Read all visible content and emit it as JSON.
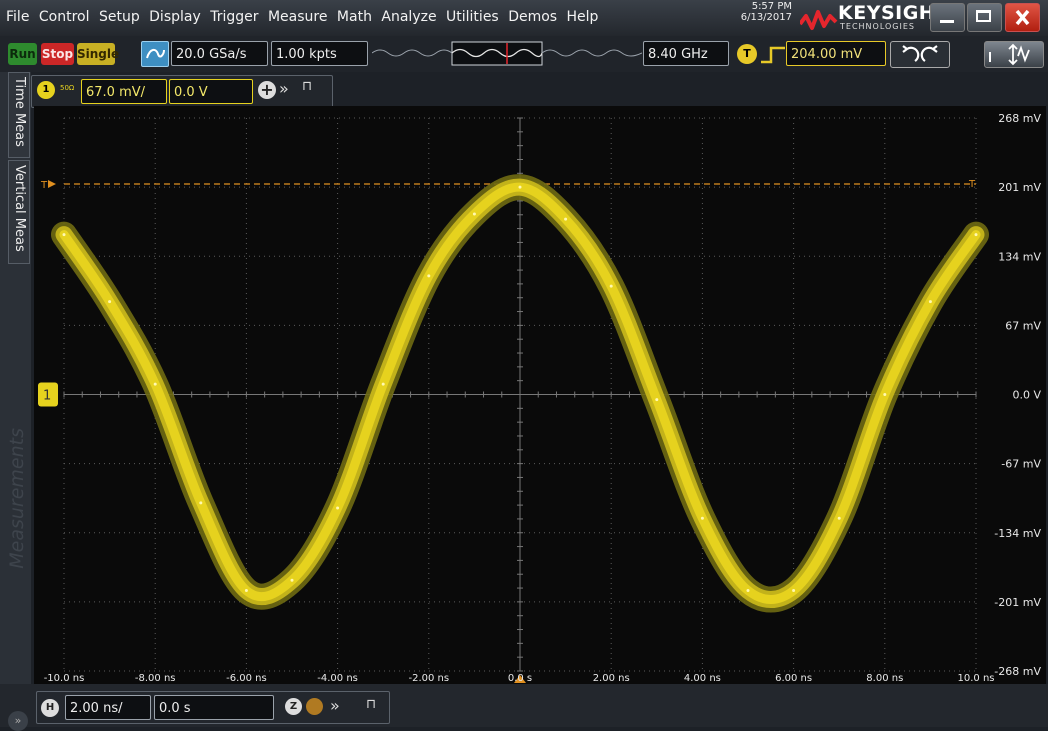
{
  "menu": [
    "File",
    "Control",
    "Setup",
    "Display",
    "Trigger",
    "Measure",
    "Math",
    "Analyze",
    "Utilities",
    "Demos",
    "Help"
  ],
  "clock": {
    "time": "5:57 PM",
    "date": "6/13/2017"
  },
  "brand": {
    "name": "KEYSIGHT",
    "sub": "TECHNOLOGIES"
  },
  "toolbar": {
    "run": "Run",
    "stop": "Stop",
    "single": "Single",
    "sample_rate": "20.0 GSa/s",
    "points": "1.00 kpts",
    "bandwidth": "8.40 GHz",
    "trigger_icon": "T",
    "trigger_level": "204.00 mV"
  },
  "sidebar": {
    "time_meas": "Time Meas",
    "vertical_meas": "Vertical Meas",
    "measurements": "Measurements"
  },
  "channel1": {
    "number": "1",
    "impedance": "50Ω",
    "scale": "67.0 mV/",
    "offset": "0.0 V"
  },
  "horizontal": {
    "icon": "H",
    "scale": "2.00 ns/",
    "position": "0.0 s",
    "zoom": "Z"
  },
  "icons": {
    "plus": "+",
    "more": "»",
    "pin": "⊓",
    "expand": "»",
    "trigger_marker": "T",
    "run_state": "acquisition-mode-icon"
  },
  "colors": {
    "channel1": "#e6d21e",
    "trigger": "#e09020",
    "run": "#2e8b2e",
    "stop": "#cc2727",
    "single": "#c8b024",
    "grid": "#5a5a5a"
  },
  "chart_data": {
    "type": "line",
    "title": "",
    "xlabel": "",
    "ylabel": "",
    "x_ticks": [
      "-10.0 ns",
      "-8.00 ns",
      "-6.00 ns",
      "-4.00 ns",
      "-2.00 ns",
      "0.0 s",
      "2.00 ns",
      "4.00 ns",
      "6.00 ns",
      "8.00 ns",
      "10.0 ns"
    ],
    "y_ticks": [
      "268 mV",
      "201 mV",
      "134 mV",
      "67 mV",
      "0.0 V",
      "-67 mV",
      "-134 mV",
      "-201 mV",
      "-268 mV"
    ],
    "xlim_ns": [
      -10,
      10
    ],
    "ylim_mV": [
      -268,
      268
    ],
    "trigger_level_mV": 204,
    "grid": true,
    "series": [
      {
        "x_ns": [
          -10,
          -9,
          -8,
          -7,
          -6,
          -5,
          -4,
          -3,
          -2,
          -1,
          0,
          1,
          2,
          3,
          4,
          5,
          6,
          7,
          8,
          9,
          10
        ],
        "y_mV": [
          155,
          90,
          10,
          -105,
          -190,
          -180,
          -110,
          10,
          115,
          175,
          201,
          170,
          105,
          -5,
          -120,
          -190,
          -190,
          -120,
          0,
          90,
          155
        ]
      }
    ]
  }
}
